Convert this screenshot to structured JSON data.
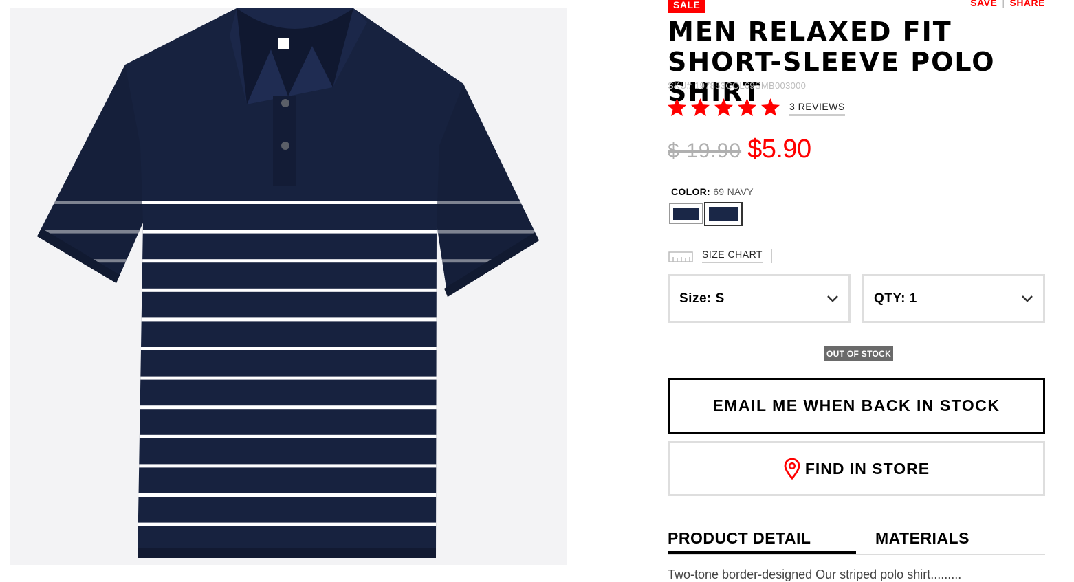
{
  "product": {
    "sale_badge": "SALE",
    "save_label": "SAVE",
    "share_label": "SHARE",
    "title": "MEN RELAXED FIT SHORT-SLEEVE POLO SHIRT",
    "sku": "SKU# 197853COL69SMB003000",
    "rating": 5,
    "rating_max": 5,
    "reviews_label": "3 REVIEWS",
    "original_price": "$ 19.90",
    "sale_price": "$5.90",
    "image_alt": "Navy polo shirt with white horizontal stripes"
  },
  "color": {
    "label": "COLOR:",
    "value": "69 NAVY",
    "swatches": [
      {
        "name": "navy-1",
        "hex": "#1a2747",
        "selected": false
      },
      {
        "name": "navy-2",
        "hex": "#1d2b4f",
        "selected": true
      }
    ]
  },
  "size_chart": {
    "label": "SIZE CHART"
  },
  "selects": {
    "size_label": "Size: S",
    "qty_label": "QTY: 1"
  },
  "stock": {
    "status": "OUT OF STOCK",
    "email_button": "EMAIL ME WHEN BACK IN STOCK",
    "store_button": "FIND IN STORE"
  },
  "tabs": {
    "detail": "PRODUCT DETAIL",
    "materials": "MATERIALS"
  },
  "description_preview": "Two-tone border-designed Our striped polo shirt.........",
  "colors": {
    "accent": "#ff0000",
    "navy": "#17223f",
    "stripe": "#ffffff",
    "border": "#dedede"
  }
}
